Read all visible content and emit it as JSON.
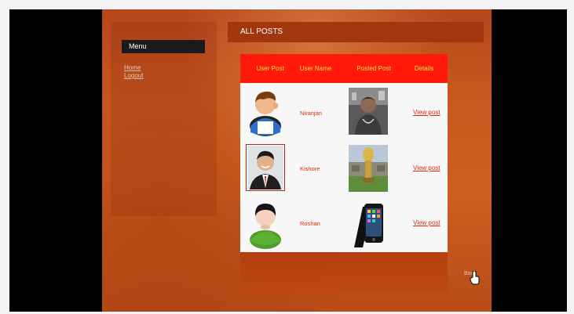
{
  "sidebar": {
    "menu_title": "Menu",
    "links": [
      "Home",
      "Logout"
    ]
  },
  "main": {
    "header": "ALL POSTS",
    "columns": [
      "User Post",
      "User Name",
      "Posted Post",
      "Details"
    ],
    "rows": [
      {
        "user_name": "Niranjan",
        "details": "View post",
        "avatar_icon": "cartoon-man-icon",
        "post_image": "photo-man-with-chain"
      },
      {
        "user_name": "Kishore",
        "details": "View post",
        "avatar_icon": "photo-man-in-suit",
        "post_image": "photo-trophy-stadium"
      },
      {
        "user_name": "Roshan",
        "details": "View post",
        "avatar_icon": "green-user-icon",
        "post_image": "iphone-icon"
      }
    ]
  },
  "footer": {
    "back_label": "Back"
  },
  "colors": {
    "header_red": "#ff1a0a",
    "header_text": "#ffe14a",
    "link_red": "#e52a0c",
    "page_orange": "#cf5e20"
  }
}
